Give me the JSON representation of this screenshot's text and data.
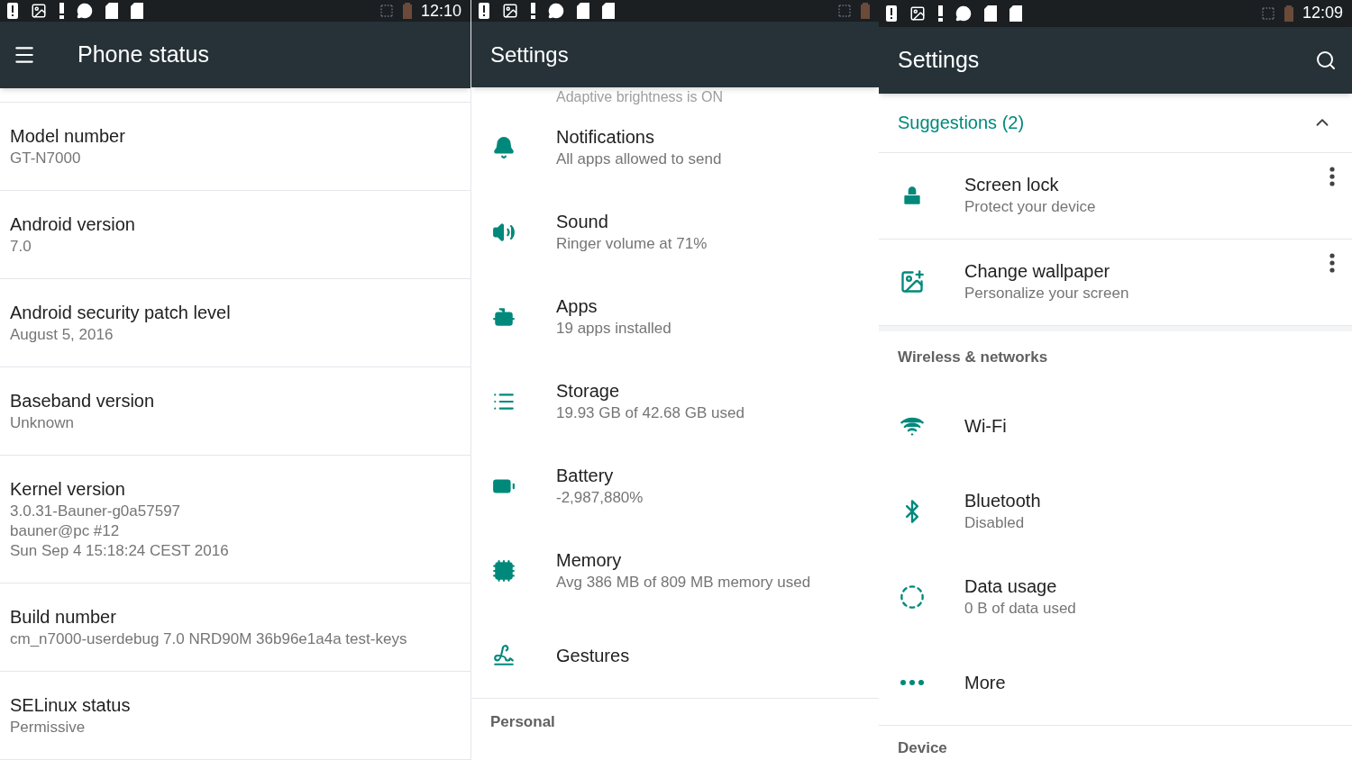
{
  "phone_status": {
    "status_bar": {
      "time": "12:10"
    },
    "toolbar": {
      "title": "Phone status"
    },
    "rows": [
      {
        "title": "Model number",
        "values": [
          "GT-N7000"
        ]
      },
      {
        "title": "Android version",
        "values": [
          "7.0"
        ]
      },
      {
        "title": "Android security patch level",
        "values": [
          "August 5, 2016"
        ]
      },
      {
        "title": "Baseband version",
        "values": [
          "Unknown"
        ]
      },
      {
        "title": "Kernel version",
        "values": [
          "3.0.31-Bauner-g0a57597",
          "bauner@pc #12",
          "Sun Sep 4 15:18:24 CEST 2016"
        ]
      },
      {
        "title": "Build number",
        "values": [
          "cm_n7000-userdebug 7.0 NRD90M 36b96e1a4a test-keys"
        ]
      },
      {
        "title": "SELinux status",
        "values": [
          "Permissive"
        ]
      }
    ]
  },
  "settings_middle": {
    "toolbar": {
      "title": "Settings"
    },
    "partial_summary": "Adaptive brightness is ON",
    "items": [
      {
        "title": "Notifications",
        "summary": "All apps allowed to send"
      },
      {
        "title": "Sound",
        "summary": "Ringer volume at 71%"
      },
      {
        "title": "Apps",
        "summary": "19 apps installed"
      },
      {
        "title": "Storage",
        "summary": "19.93 GB of 42.68 GB used"
      },
      {
        "title": "Battery",
        "summary": "-2,987,880%"
      },
      {
        "title": "Memory",
        "summary": "Avg 386 MB of 809 MB memory used"
      },
      {
        "title": "Gestures"
      }
    ],
    "section_header": "Personal"
  },
  "settings_right": {
    "status_bar": {
      "time": "12:09"
    },
    "toolbar": {
      "title": "Settings"
    },
    "suggestions": {
      "title": "Suggestions (2)",
      "expanded": true,
      "items": [
        {
          "title": "Screen lock",
          "summary": "Protect your device"
        },
        {
          "title": "Change wallpaper",
          "summary": "Personalize your screen"
        }
      ]
    },
    "section_header": "Wireless & networks",
    "items": [
      {
        "title": "Wi-Fi"
      },
      {
        "title": "Bluetooth",
        "summary": "Disabled"
      },
      {
        "title": "Data usage",
        "summary": "0 B of data used"
      },
      {
        "title": "More"
      }
    ],
    "next_section_header": "Device"
  }
}
